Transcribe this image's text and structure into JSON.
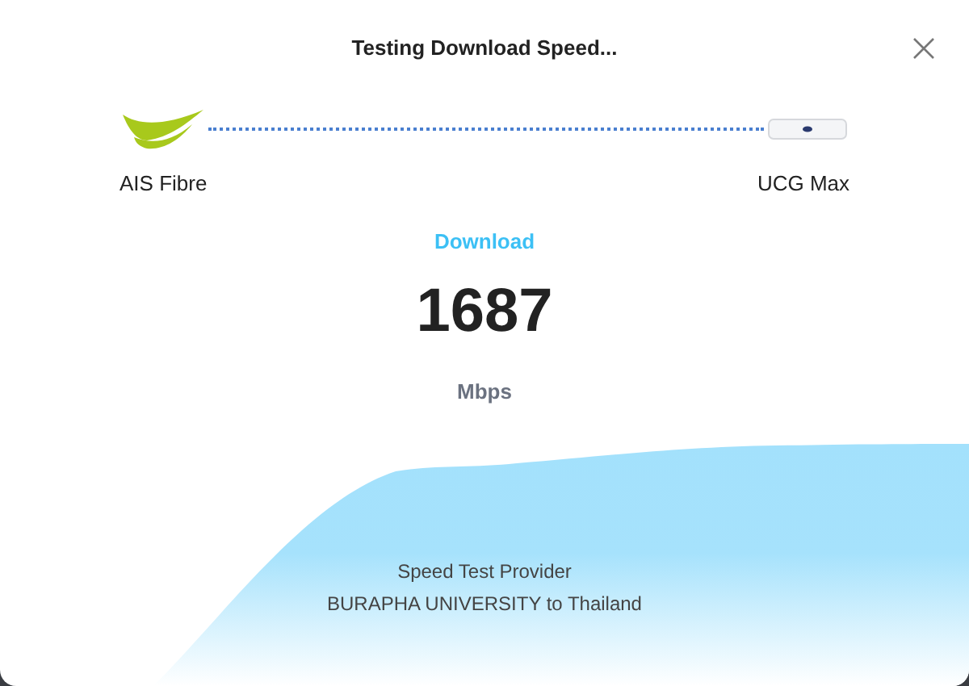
{
  "dialog": {
    "title": "Testing Download Speed..."
  },
  "connection": {
    "source": "AIS Fibre",
    "target": "UCG Max"
  },
  "result": {
    "label": "Download",
    "value": "1687",
    "unit": "Mbps"
  },
  "provider": {
    "heading": "Speed Test Provider",
    "name": "BURAPHA UNIVERSITY to Thailand"
  }
}
